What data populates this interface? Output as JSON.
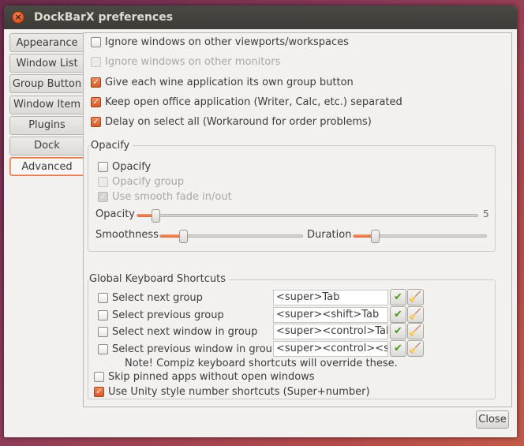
{
  "window": {
    "title": "DockBarX preferences"
  },
  "tabs": [
    {
      "label": "Appearance"
    },
    {
      "label": "Window List"
    },
    {
      "label": "Group Button"
    },
    {
      "label": "Window Item"
    },
    {
      "label": "Plugins"
    },
    {
      "label": "Dock"
    },
    {
      "label": "Advanced"
    }
  ],
  "options": {
    "ignore_viewports": "Ignore windows on other viewports/workspaces",
    "ignore_monitors": "Ignore windows on other monitors",
    "wine_group": "Give each wine application its own group button",
    "office_separated": "Keep open office application (Writer, Calc, etc.) separated",
    "delay_select": "Delay on select all (Workaround for order problems)"
  },
  "opacify": {
    "frame_label": "Opacify",
    "opacify": "Opacify",
    "opacify_group": "Opacify group",
    "smooth_fade": "Use smooth fade in/out",
    "opacity_label": "Opacity",
    "opacity_value": "5",
    "smoothness_label": "Smoothness",
    "duration_label": "Duration"
  },
  "shortcuts": {
    "frame_label": "Global Keyboard Shortcuts",
    "items": [
      {
        "label": "Select next group",
        "value": "<super>Tab"
      },
      {
        "label": "Select previous group",
        "value": "<super><shift>Tab"
      },
      {
        "label": "Select next window in group",
        "value": "<super><control>Tab"
      },
      {
        "label": "Select previous window in group",
        "value": "<super><control><shift>Tab"
      }
    ],
    "note": "Note! Compiz keyboard shortcuts will override these.",
    "skip_pinned": "Skip pinned apps without open windows",
    "unity_numbers": "Use Unity style number shortcuts (Super+number)"
  },
  "buttons": {
    "close": "Close"
  },
  "colors": {
    "accent": "#e06a3a",
    "apply_icon": "#4a9a1a",
    "clear_icon": "#c99a1a"
  }
}
